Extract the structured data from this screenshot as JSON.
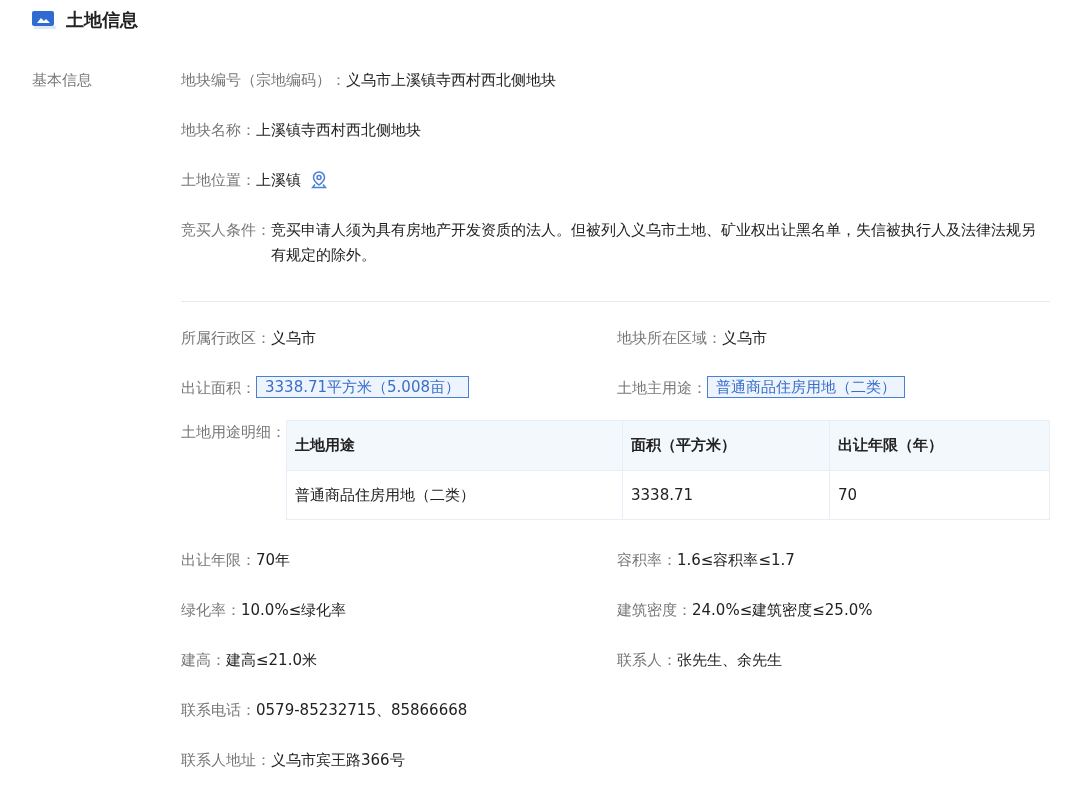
{
  "header": {
    "title": "土地信息"
  },
  "section": {
    "label": "基本信息",
    "top_fields": [
      {
        "kind": "text",
        "label": "地块编号（宗地编码）：",
        "value": "义乌市上溪镇寺西村西北侧地块"
      },
      {
        "kind": "text",
        "label": "地块名称：",
        "value": "上溪镇寺西村西北侧地块"
      },
      {
        "kind": "location",
        "label": "土地位置：",
        "value": "上溪镇"
      },
      {
        "kind": "text",
        "label": "竞买人条件：",
        "value": "竞买申请人须为具有房地产开发资质的法人。但被列入义乌市土地、矿业权出让黑名单，失信被执行人及法律法规另有规定的除外。"
      }
    ],
    "grid_fields": [
      {
        "kind": "text",
        "label": "所属行政区：",
        "value": "义乌市"
      },
      {
        "kind": "text",
        "label": "地块所在区域：",
        "value": "义乌市"
      },
      {
        "kind": "tag",
        "label": "出让面积：",
        "value": "3338.71平方米（5.008亩）"
      },
      {
        "kind": "tag",
        "label": "土地主用途：",
        "value": "普通商品住房用地（二类）"
      },
      {
        "kind": "table",
        "label": "土地用途明细：",
        "columns": [
          "土地用途",
          "面积（平方米）",
          "出让年限（年）"
        ],
        "rows": [
          [
            "普通商品住房用地（二类）",
            "3338.71",
            "70"
          ]
        ]
      },
      {
        "kind": "text",
        "label": "出让年限：",
        "value": "70年"
      },
      {
        "kind": "text",
        "label": "容积率：",
        "value": "1.6≤容积率≤1.7"
      },
      {
        "kind": "text",
        "label": "绿化率：",
        "value": "10.0%≤绿化率"
      },
      {
        "kind": "text",
        "label": "建筑密度：",
        "value": "24.0%≤建筑密度≤25.0%"
      },
      {
        "kind": "text",
        "label": "建高：",
        "value": "建高≤21.0米"
      },
      {
        "kind": "text",
        "label": "联系人：",
        "value": "张先生、余先生"
      },
      {
        "kind": "wide",
        "label": "联系电话：",
        "value": "0579-85232715、85866668"
      },
      {
        "kind": "wide",
        "label": "联系人地址：",
        "value": "义乌市宾王路366号"
      }
    ]
  }
}
